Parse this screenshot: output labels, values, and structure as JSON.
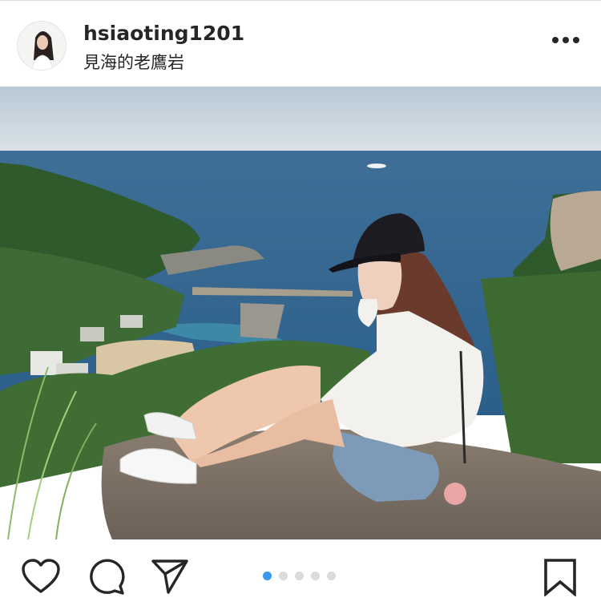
{
  "post": {
    "username": "hsiaoting1201",
    "location": "見海的老鷹岩"
  },
  "icons": {
    "more": "more-options-icon",
    "like": "heart-icon",
    "comment": "comment-icon",
    "share": "paper-plane-icon",
    "save": "bookmark-icon"
  },
  "carousel": {
    "total": 5,
    "active_index": 0,
    "active_color": "#3897f0",
    "inactive_color": "#dbdbdb"
  }
}
